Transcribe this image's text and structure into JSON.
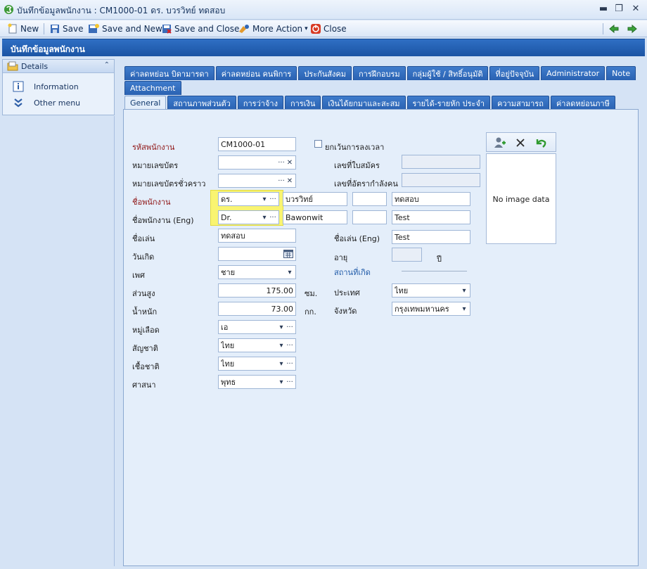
{
  "window": {
    "title": "บันทึกข้อมูลพนักงาน : CM1000-01 ดร. บวรวิทย์ ทดสอบ",
    "minimize": "▬",
    "restore": "❐",
    "close": "✕"
  },
  "toolbar": {
    "new": "New",
    "save": "Save",
    "save_and_new": "Save and New",
    "save_and_close": "Save and Close",
    "more_action": "More Action",
    "close": "Close"
  },
  "header": {
    "title": "บันทึกข้อมูลพนักงาน"
  },
  "left_panel": {
    "title": "Details",
    "collapse": "⌃",
    "items": [
      "Information",
      "Other menu"
    ]
  },
  "tabs": {
    "row1": [
      "ค่าลดหย่อน บิดามารดา",
      "ค่าลดหย่อน คนพิการ",
      "ประกันสังคม",
      "การฝึกอบรม",
      "กลุ่มผู้ใช้ / สิทธิ์อนุมัติ",
      "ที่อยู่ปัจจุบัน",
      "Administrator",
      "Note"
    ],
    "row2": [
      "Attachment"
    ],
    "row3": [
      "General",
      "สถานภาพส่วนตัว",
      "การว่าจ้าง",
      "การเงิน",
      "เงินได้ยกมาและสะสม",
      "รายได้-รายหัก ประจำ",
      "ความสามารถ",
      "ค่าลดหย่อนภาษี"
    ]
  },
  "form": {
    "employee_code": {
      "label": "รหัสพนักงาน",
      "value": "CM1000-01"
    },
    "exempt_checkbox": {
      "label": "ยกเว้นการลงเวลา"
    },
    "card_no": {
      "label": "หมายเลขบัตร",
      "value": ""
    },
    "application_no": {
      "label": "เลขที่ใบสมัคร",
      "value": ""
    },
    "temp_card_no": {
      "label": "หมายเลขบัตรชั่วคราว",
      "value": ""
    },
    "manpower_no": {
      "label": "เลขที่อัตรากำลังคน",
      "value": ""
    },
    "name_th": {
      "label": "ชื่อพนักงาน",
      "prefix": "ดร.",
      "first": "บวรวิทย์",
      "middle": "",
      "last": "ทดสอบ"
    },
    "name_en": {
      "label": "ชื่อพนักงาน (Eng)",
      "prefix": "Dr.",
      "first": "Bawonwit",
      "middle": "",
      "last": "Test"
    },
    "nickname": {
      "label": "ชื่อเล่น",
      "value": "ทดสอบ"
    },
    "nickname_en": {
      "label": "ชื่อเล่น (Eng)",
      "value": "Test"
    },
    "birthdate": {
      "label": "วันเกิด",
      "value": ""
    },
    "age": {
      "label": "อายุ",
      "value": "",
      "unit": "ปี"
    },
    "gender": {
      "label": "เพศ",
      "value": "ชาย"
    },
    "birthplace": {
      "label": "สถานที่เกิด"
    },
    "height": {
      "label": "ส่วนสูง",
      "value": "175.00",
      "unit": "ซม."
    },
    "country": {
      "label": "ประเทศ",
      "value": "ไทย"
    },
    "weight": {
      "label": "น้ำหนัก",
      "value": "73.00",
      "unit": "กก."
    },
    "province": {
      "label": "จังหวัด",
      "value": "กรุงเทพมหานคร"
    },
    "blood_type": {
      "label": "หมู่เลือด",
      "value": "เอ"
    },
    "nationality": {
      "label": "สัญชาติ",
      "value": "ไทย"
    },
    "race": {
      "label": "เชื้อชาติ",
      "value": "ไทย"
    },
    "religion": {
      "label": "ศาสนา",
      "value": "พุทธ"
    }
  },
  "photo": {
    "placeholder": "No image data"
  },
  "glyphs": {
    "ellipsis": "···",
    "clear": "✕",
    "dropdown": "▾"
  }
}
